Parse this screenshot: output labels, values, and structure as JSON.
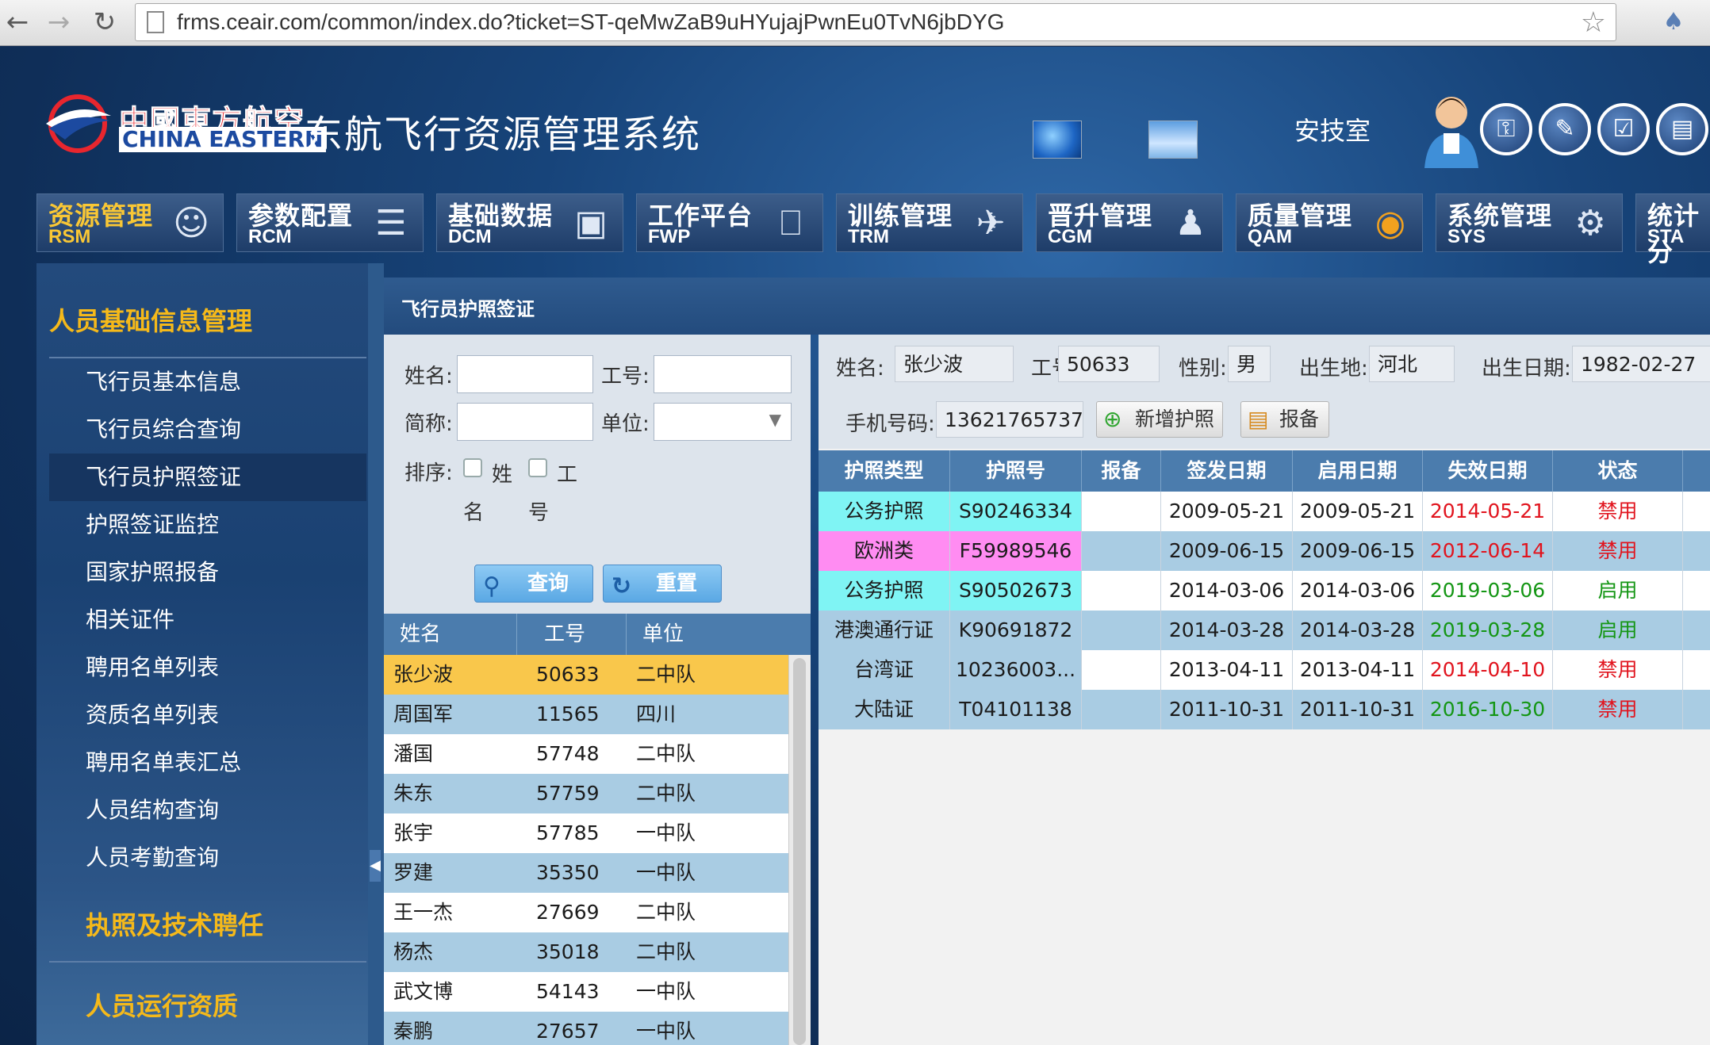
{
  "browser": {
    "url": "frms.ceair.com/common/index.do?ticket=ST-qeMwZaB9uHYujajPwnEu0TvN6jbDYG"
  },
  "header": {
    "logo_cn": "中國東方航空",
    "logo_en": "CHINA EASTERN",
    "system_title": "东航飞行资源管理系统",
    "user_label": "安技室"
  },
  "modules": [
    {
      "cn": "资源管理",
      "en": "RSM",
      "icon": "people-icon"
    },
    {
      "cn": "参数配置",
      "en": "RCM",
      "icon": "books-icon"
    },
    {
      "cn": "基础数据",
      "en": "DCM",
      "icon": "database-icon"
    },
    {
      "cn": "工作平台",
      "en": "FWP",
      "icon": "computer-icon"
    },
    {
      "cn": "训练管理",
      "en": "TRM",
      "icon": "plane-icon"
    },
    {
      "cn": "晋升管理",
      "en": "CGM",
      "icon": "pilot-icon"
    },
    {
      "cn": "质量管理",
      "en": "QAM",
      "icon": "medal-icon"
    },
    {
      "cn": "系统管理",
      "en": "SYS",
      "icon": "gear-icon"
    },
    {
      "cn": "统计分",
      "en": "STA",
      "icon": ""
    }
  ],
  "nav": {
    "section1": "人员基础信息管理",
    "items": [
      "飞行员基本信息",
      "飞行员综合查询",
      "飞行员护照签证",
      "护照签证监控",
      "国家护照报备",
      "相关证件",
      "聘用名单列表",
      "资质名单列表",
      "聘用名单表汇总",
      "人员结构查询",
      "人员考勤查询"
    ],
    "section2": "执照及技术聘任",
    "section3": "人员运行资质"
  },
  "main": {
    "title": "飞行员护照签证"
  },
  "search": {
    "name_label": "姓名:",
    "id_label": "工号:",
    "abbr_label": "简称:",
    "unit_label": "单位:",
    "sort_label": "排序:",
    "sort_opt1_a": "姓",
    "sort_opt1_b": "名",
    "sort_opt2_a": "工",
    "sort_opt2_b": "号",
    "query_btn": "查询",
    "reset_btn": "重置"
  },
  "crew": {
    "headers": [
      "姓名",
      "工号",
      "单位"
    ],
    "rows": [
      [
        "张少波",
        "50633",
        "二中队"
      ],
      [
        "周国军",
        "11565",
        "四川"
      ],
      [
        "潘国",
        "57748",
        "二中队"
      ],
      [
        "朱东",
        "57759",
        "二中队"
      ],
      [
        "张宇",
        "57785",
        "一中队"
      ],
      [
        "罗建",
        "35350",
        "一中队"
      ],
      [
        "王一杰",
        "27669",
        "二中队"
      ],
      [
        "杨杰",
        "35018",
        "二中队"
      ],
      [
        "武文博",
        "54143",
        "一中队"
      ],
      [
        "秦鹏",
        "27657",
        "一中队"
      ]
    ]
  },
  "detail": {
    "name_label": "姓名:",
    "name": "张少波",
    "id_label": "工号:",
    "id": "50633",
    "gender_label": "性别:",
    "gender": "男",
    "birthplace_label": "出生地:",
    "birthplace": "河北",
    "birthdate_label": "出生日期:",
    "birthdate": "1982-02-27",
    "phone_label": "手机号码:",
    "phone": "13621765737",
    "add_btn": "新增护照",
    "report_btn": "报备"
  },
  "passports": {
    "headers": [
      "护照类型",
      "护照号",
      "报备",
      "签发日期",
      "启用日期",
      "失效日期",
      "状态"
    ],
    "rows": [
      {
        "type": "公务护照",
        "no": "S90246334",
        "report": "",
        "issue": "2009-05-21",
        "start": "2009-05-21",
        "expire": "2014-05-21",
        "status": "禁用"
      },
      {
        "type": "欧洲类",
        "no": "F59989546",
        "report": "",
        "issue": "2009-06-15",
        "start": "2009-06-15",
        "expire": "2012-06-14",
        "status": "禁用"
      },
      {
        "type": "公务护照",
        "no": "S90502673",
        "report": "",
        "issue": "2014-03-06",
        "start": "2014-03-06",
        "expire": "2019-03-06",
        "status": "启用"
      },
      {
        "type": "港澳通行证",
        "no": "K90691872",
        "report": "",
        "issue": "2014-03-28",
        "start": "2014-03-28",
        "expire": "2019-03-28",
        "status": "启用"
      },
      {
        "type": "台湾证",
        "no": "10236003...",
        "report": "",
        "issue": "2013-04-11",
        "start": "2013-04-11",
        "expire": "2014-04-10",
        "status": "禁用"
      },
      {
        "type": "大陆证",
        "no": "T04101138",
        "report": "",
        "issue": "2011-10-31",
        "start": "2011-10-31",
        "expire": "2016-10-30",
        "status": "禁用"
      }
    ]
  },
  "colors": {
    "accent_yellow": "#f5b91a",
    "status_red": "#e1141e",
    "status_green": "#149614",
    "cyan_cell": "#7ff4f4",
    "pink_cell": "#ff8cf2",
    "row_blue": "#a9cce3",
    "row_selected": "#f9c74b"
  }
}
